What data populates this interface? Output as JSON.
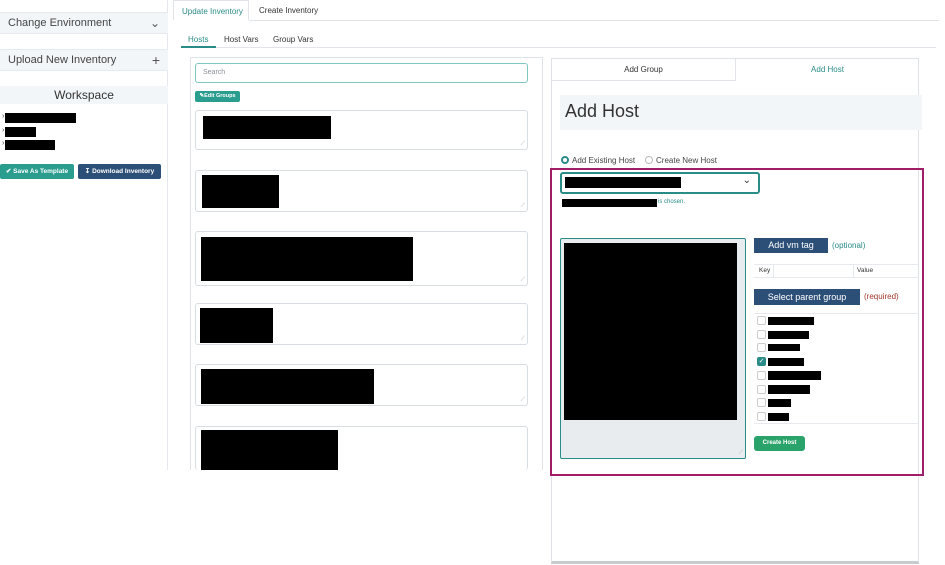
{
  "sidebar": {
    "change_environment": "Change Environment",
    "upload_inventory": "Upload New Inventory",
    "workspace_title": "Workspace",
    "save_template": "Save As Template",
    "download_inventory": "Download Inventory",
    "colors": {
      "teal": "#2a9d8f",
      "navy": "#2c4f78"
    }
  },
  "main_tabs": {
    "update": "Update Inventory",
    "create": "Create Inventory"
  },
  "sub_tabs": {
    "hosts": "Hosts",
    "host_vars": "Host Vars",
    "group_vars": "Group Vars"
  },
  "hosts": {
    "search_placeholder": "Search",
    "edit_groups": "Edit Groups"
  },
  "right": {
    "tab_add_group": "Add Group",
    "tab_add_host": "Add Host",
    "title": "Add Host",
    "radio_existing": "Add Existing Host",
    "radio_new": "Create New Host",
    "chosen_suffix": "is chosen.",
    "add_vm_tag": "Add vm tag",
    "optional": "(optional)",
    "key_header": "Key",
    "value_header": "Value",
    "select_parent_group": "Select parent group",
    "required": "(required)",
    "create_host": "Create Host",
    "colors": {
      "accent": "#2a8c87",
      "highlight": "#a21d68",
      "required": "#a0392c"
    }
  }
}
